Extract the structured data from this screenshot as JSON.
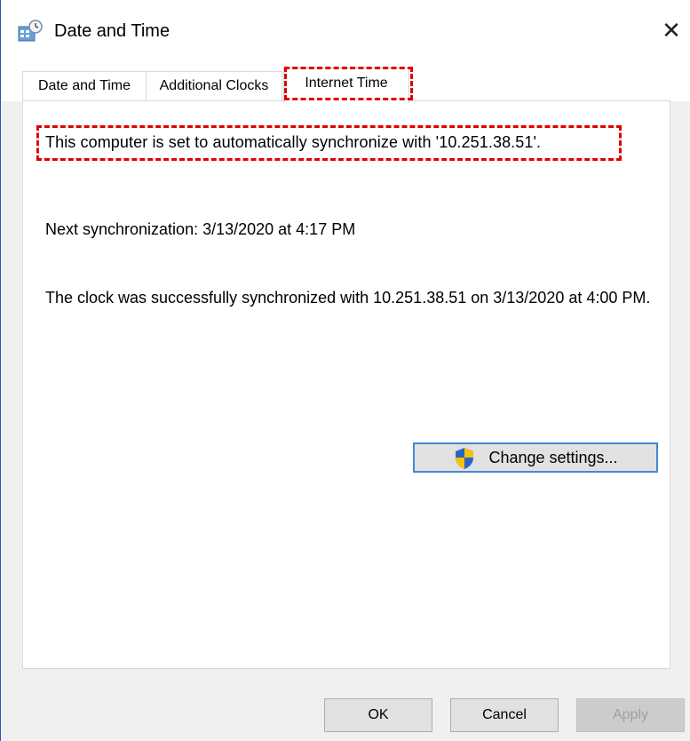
{
  "window": {
    "title": "Date and Time",
    "close_symbol": "✕"
  },
  "tabs": [
    {
      "label": "Date and Time",
      "selected": false
    },
    {
      "label": "Additional Clocks",
      "selected": false
    },
    {
      "label": "Internet Time",
      "selected": true
    }
  ],
  "internet_time": {
    "sync_status": "This computer is set to automatically synchronize with '10.251.38.51'.",
    "next_sync": "Next synchronization: 3/13/2020 at 4:17 PM",
    "last_result": "The clock was successfully synchronized with 10.251.38.51 on 3/13/2020 at 4:00 PM.",
    "change_settings_label": "Change settings..."
  },
  "footer": {
    "ok_label": "OK",
    "cancel_label": "Cancel",
    "apply_label": "Apply"
  },
  "icons": {
    "app": "date-time-icon",
    "change_settings": "uac-shield-icon"
  },
  "colors": {
    "highlight": "#e00000",
    "button_focus": "#3c8ad8",
    "window_border": "#1d5fa8"
  }
}
